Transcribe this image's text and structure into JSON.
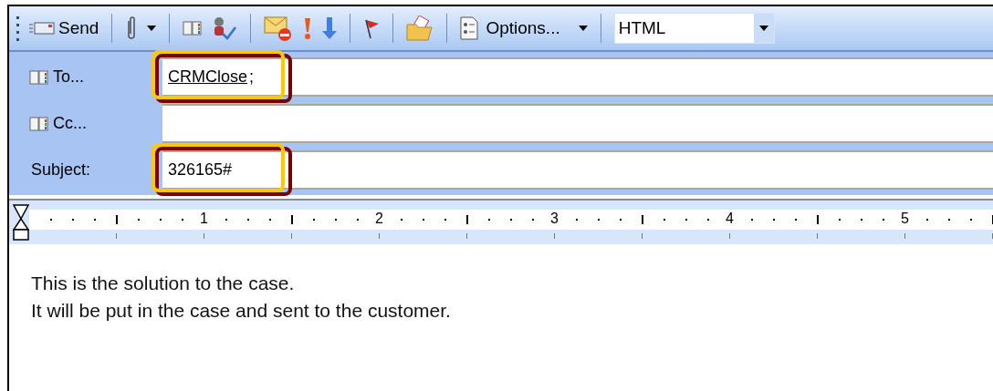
{
  "toolbar": {
    "send": "Send",
    "options": "Options...",
    "format": "HTML"
  },
  "recipients": [
    {
      "label": "To...",
      "value": "CRMClose",
      "separator": ";",
      "kind": "address",
      "highlighted": true
    },
    {
      "label": "Cc...",
      "kind": "address",
      "highlighted": false
    },
    {
      "label": "Subject:",
      "value": "326165#",
      "kind": "plain",
      "highlighted": true
    }
  ],
  "ruler": {
    "labels": [
      "1",
      "2",
      "3",
      "4",
      "5"
    ]
  },
  "body": [
    "This is the solution to the case.",
    "It will be put in the case and sent to the customer."
  ]
}
